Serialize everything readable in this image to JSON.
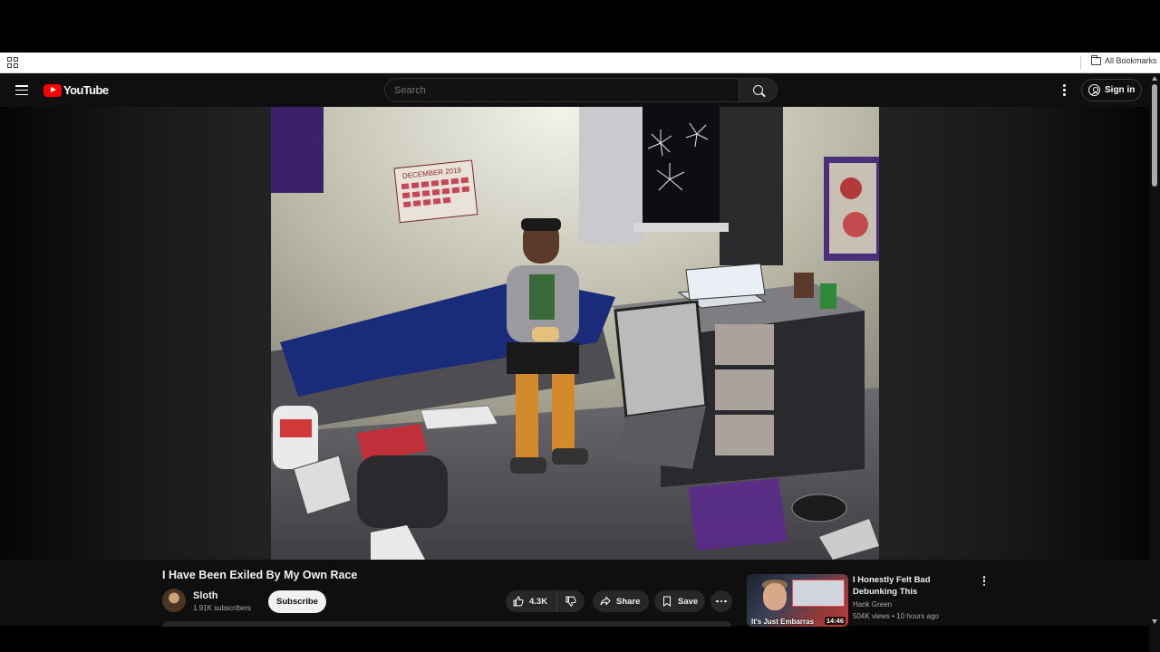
{
  "browser": {
    "all_bookmarks_label": "All Bookmarks"
  },
  "masthead": {
    "logo_text": "YouTube",
    "search_placeholder": "Search",
    "sign_in_label": "Sign in"
  },
  "video": {
    "title": "I Have Been Exiled By My Own Race",
    "channel_name": "Sloth",
    "subscriber_count": "1.91K subscribers",
    "subscribe_label": "Subscribe",
    "like_count": "4.3K",
    "share_label": "Share",
    "save_label": "Save",
    "calendar_text": "DECEMBER 2019"
  },
  "recommendations": [
    {
      "title": "I Honestly Felt Bad Debunking This",
      "channel": "Hank Green",
      "views": "504K views",
      "age": "10 hours ago",
      "meta_separator": " • ",
      "duration": "14:46",
      "thumbnail_caption": "It's Just Embarras"
    }
  ],
  "colors": {
    "youtube_red": "#ff0000",
    "page_background": "#0f0f0f",
    "button_background": "#272727"
  }
}
